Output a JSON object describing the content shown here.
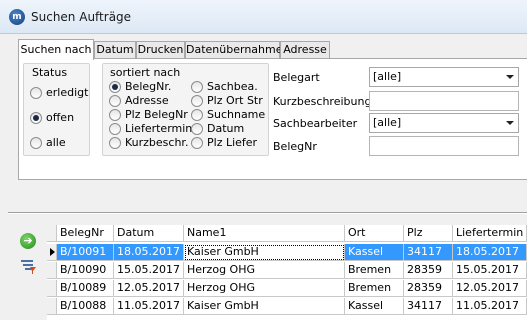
{
  "window": {
    "title": "Suchen Aufträge",
    "icon": "app-logo-icon"
  },
  "tabs": [
    {
      "label": "Suchen nach",
      "active": true
    },
    {
      "label": "Datum",
      "active": false
    },
    {
      "label": "Drucken",
      "active": false
    },
    {
      "label": "Datenübernahme",
      "active": false
    },
    {
      "label": "Adresse",
      "active": false
    }
  ],
  "status_group": {
    "label": "Status",
    "options": [
      {
        "label": "erledigt",
        "checked": false
      },
      {
        "label": "offen",
        "checked": true
      },
      {
        "label": "alle",
        "checked": false
      }
    ]
  },
  "sort_group": {
    "label": "sortiert nach",
    "options": [
      {
        "label": "BelegNr.",
        "checked": true
      },
      {
        "label": "Adresse",
        "checked": false
      },
      {
        "label": "Plz BelegNr",
        "checked": false
      },
      {
        "label": "Liefertermin",
        "checked": false
      },
      {
        "label": "Kurzbeschr.",
        "checked": false
      },
      {
        "label": "Sachbea.",
        "checked": false
      },
      {
        "label": "Plz Ort Str",
        "checked": false
      },
      {
        "label": "Suchname",
        "checked": false
      },
      {
        "label": "Datum",
        "checked": false
      },
      {
        "label": "Plz Liefer",
        "checked": false
      }
    ]
  },
  "fields": {
    "belegart": {
      "label": "Belegart",
      "value": "[alle]"
    },
    "kurzbeschreibung": {
      "label": "Kurzbeschreibung",
      "value": ""
    },
    "sachbearbeiter": {
      "label": "Sachbearbeiter",
      "value": "[alle]"
    },
    "belegnr": {
      "label": "BelegNr",
      "value": ""
    }
  },
  "side_buttons": {
    "go": "go-arrow-icon",
    "filter": "filter-icon"
  },
  "table": {
    "columns": [
      "BelegNr",
      "Datum",
      "Name1",
      "Ort",
      "Plz",
      "Liefertermin"
    ],
    "rows": [
      [
        "B/10091",
        "18.05.2017",
        "Kaiser GmbH",
        "Kassel",
        "34117",
        "18.05.2017"
      ],
      [
        "B/10090",
        "15.05.2017",
        "Herzog OHG",
        "Bremen",
        "28359",
        "15.05.2017"
      ],
      [
        "B/10089",
        "12.05.2017",
        "Herzog OHG",
        "Bremen",
        "28359",
        "12.05.2017"
      ],
      [
        "B/10088",
        "11.05.2017",
        "Kaiser GmbH",
        "Kassel",
        "34117",
        "11.05.2017"
      ]
    ],
    "selected_row": 0
  },
  "colors": {
    "selection": "#3399ff",
    "titlebar": "#dde8f5"
  }
}
